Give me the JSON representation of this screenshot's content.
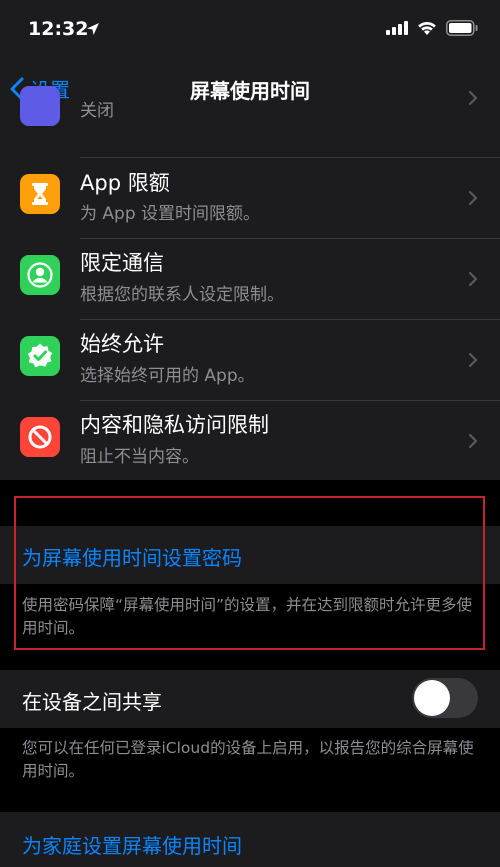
{
  "status_bar": {
    "time": "12:32"
  },
  "nav": {
    "back_label": "设置",
    "title": "屏幕使用时间"
  },
  "list": {
    "items": [
      {
        "title": "",
        "subtitle": "关闭",
        "icon": "moon-icon",
        "color": "#5e5ce6"
      },
      {
        "title": "App 限额",
        "subtitle": "为 App 设置时间限额。",
        "icon": "hourglass-icon",
        "color": "#ff9f0a"
      },
      {
        "title": "限定通信",
        "subtitle": "根据您的联系人设定限制。",
        "icon": "contact-icon",
        "color": "#30d158"
      },
      {
        "title": "始终允许",
        "subtitle": "选择始终可用的 App。",
        "icon": "checkmark-badge-icon",
        "color": "#30d158"
      },
      {
        "title": "内容和隐私访问限制",
        "subtitle": "阻止不当内容。",
        "icon": "prohibited-icon",
        "color": "#ff453a"
      }
    ]
  },
  "passcode": {
    "label": "为屏幕使用时间设置密码",
    "description": "使用密码保障“屏幕使用时间”的设置，并在达到限额时允许更多使用时间。"
  },
  "share": {
    "label": "在设备之间共享",
    "enabled": false,
    "description": "您可以在任何已登录iCloud的设备上启用，以报告您的综合屏幕使用时间。"
  },
  "family": {
    "label": "为家庭设置屏幕使用时间"
  },
  "colors": {
    "accent": "#0a84ff",
    "highlight_border": "#c8232c"
  }
}
